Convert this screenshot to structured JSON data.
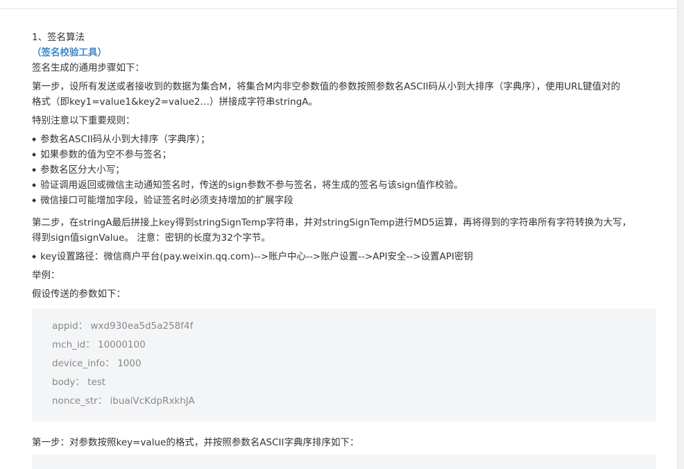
{
  "section_title": "1、签名算法",
  "tool_link": "（签名校验工具）",
  "intro": "签名生成的通用步骤如下：",
  "step1_line1": "第一步，设所有发送或者接收到的数据为集合M，将集合M内非空参数值的参数按照参数名ASCII码从小到大排序（字典序），使用URL键值对的",
  "step1_line2": "格式（即key1=value1&key2=value2…）拼接成字符串stringA。",
  "rules_title": "特别注意以下重要规则：",
  "rules": [
    "参数名ASCII码从小到大排序（字典序）；",
    "如果参数的值为空不参与签名；",
    "参数名区分大小写；",
    "验证调用返回或微信主动通知签名时，传送的sign参数不参与签名，将生成的签名与该sign值作校验。",
    "微信接口可能增加字段，验证签名时必须支持增加的扩展字段"
  ],
  "step2_line1": "第二步，在stringA最后拼接上key得到stringSignTemp字符串，并对stringSignTemp进行MD5运算，再将得到的字符串所有字符转换为大写，",
  "step2_line2": "得到sign值signValue。 注意：密钥的长度为32个字节。",
  "key_path": "key设置路径：微信商户平台(pay.weixin.qq.com)-->账户中心-->账户设置-->API安全-->设置API密钥",
  "example_label": "举例：",
  "params_intro": "假设传送的参数如下：",
  "params": [
    "appid： wxd930ea5d5a258f4f",
    "mch_id： 10000100",
    "device_info： 1000",
    "body： test",
    "nonce_str： ibuaiVcKdpRxkhJA"
  ],
  "step3": "第一步：对参数按照key=value的格式，并按照参数名ASCII字典序排序如下："
}
